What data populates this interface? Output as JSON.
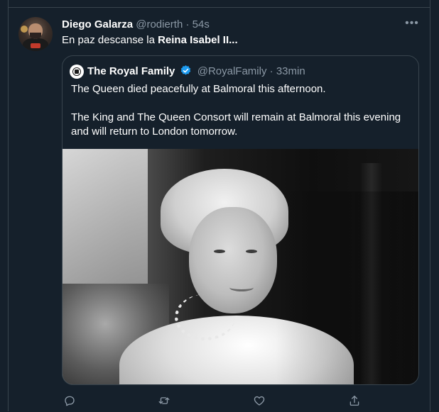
{
  "tweet": {
    "author_name": "Diego Galarza",
    "author_handle": "@rodierth",
    "separator": "·",
    "time": "54s",
    "text_prefix": "En paz descanse la ",
    "text_bold": "Reina Isabel II...",
    "more_icon": "more-dots-icon"
  },
  "quote": {
    "author_name": "The Royal Family",
    "verified_icon": "verified-badge-icon",
    "author_handle": "@RoyalFamily",
    "separator": "·",
    "time": "33min",
    "paragraphs": [
      "The Queen died peacefully at Balmoral this afternoon.",
      "The King and The Queen Consort will remain at Balmoral this evening and will return to London tomorrow."
    ],
    "photo_icon": "photo-image"
  },
  "actions": [
    {
      "icon": "reply-icon"
    },
    {
      "icon": "retweet-icon"
    },
    {
      "icon": "like-icon"
    },
    {
      "icon": "share-icon"
    }
  ],
  "colors": {
    "background": "#15202b",
    "border": "#38444d",
    "primary_text": "#ffffff",
    "secondary_text": "#8b98a5",
    "verified": "#1d9bf0"
  }
}
